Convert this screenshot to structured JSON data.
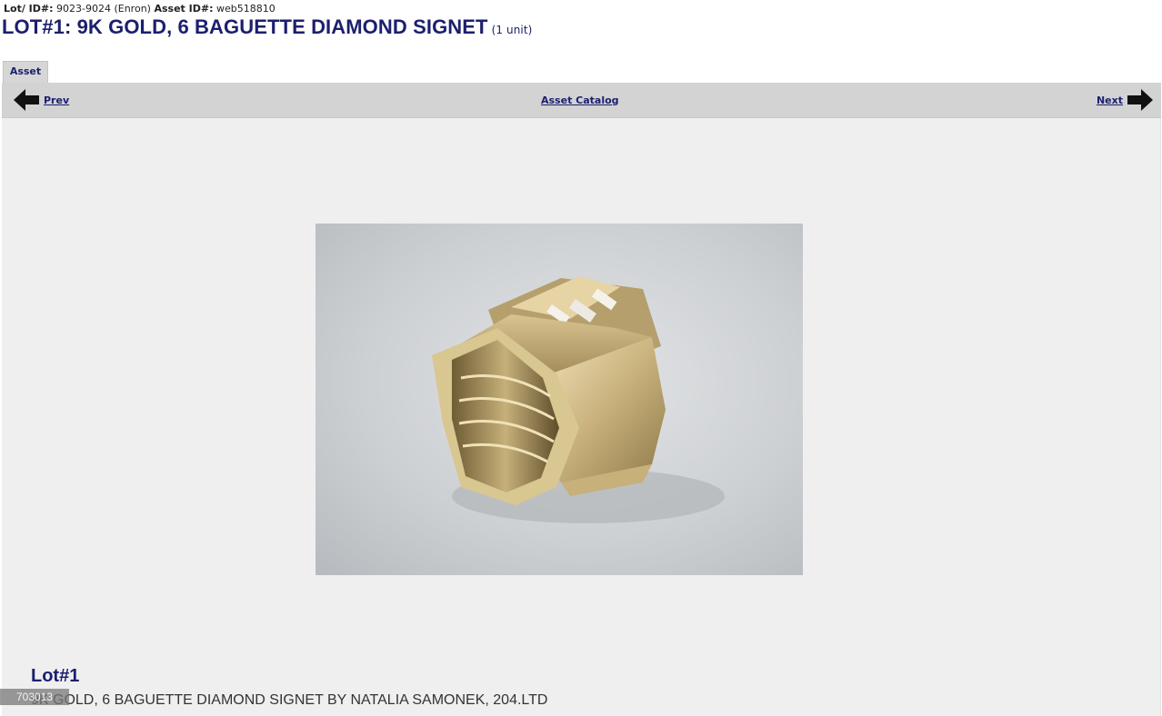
{
  "header": {
    "lot_id_label": "Lot/ ID#:",
    "lot_id_value": "9023-9024 (Enron)",
    "asset_id_label": "Asset ID#:",
    "asset_id_value": "web518810",
    "title": "LOT#1: 9K GOLD, 6 BAGUETTE DIAMOND SIGNET",
    "units": "(1 unit)"
  },
  "tabs": [
    {
      "label": "Asset",
      "active": true
    }
  ],
  "nav": {
    "prev_label": "Prev",
    "catalog_label": "Asset Catalog",
    "next_label": "Next"
  },
  "main": {
    "image_subject": "gold hexagonal ring with baguette diamonds",
    "lot_label": "Lot#1",
    "lot_description": "9K GOLD, 6 BAGUETTE DIAMOND SIGNET BY NATALIA SAMONEK, 204.LTD"
  },
  "overlay": {
    "badge_text": "703013"
  },
  "colors": {
    "title_navy": "#1b1f6e",
    "navbar_gray": "#d3d3d3",
    "content_bg": "#efefef"
  }
}
